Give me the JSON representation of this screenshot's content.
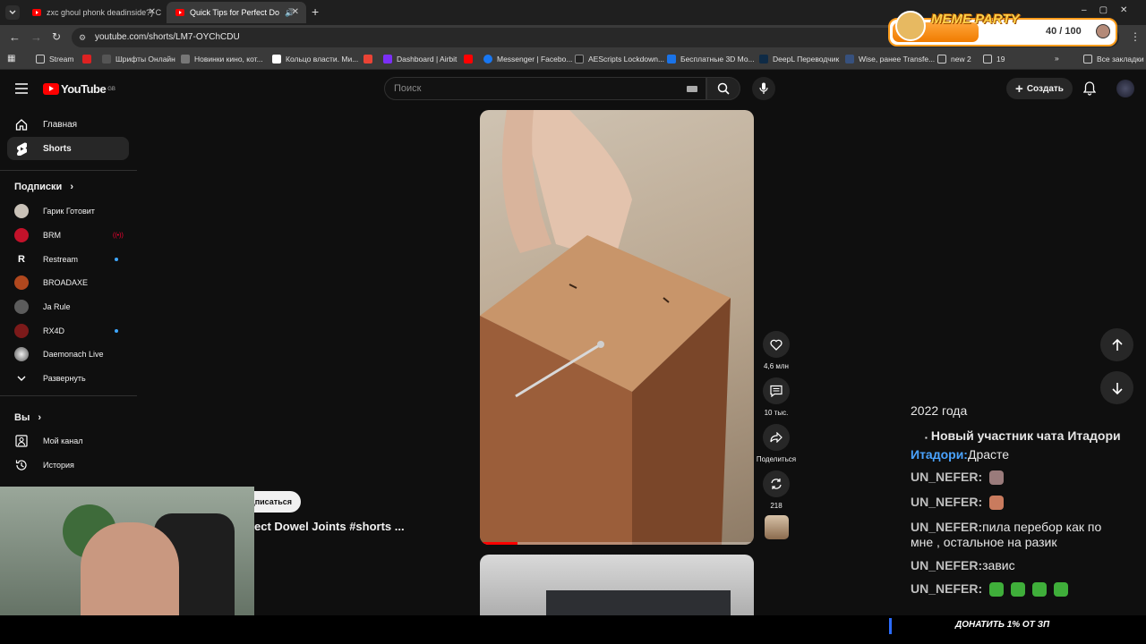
{
  "browser": {
    "tabs": [
      {
        "title": "zxc ghoul phonk deadinside?) C"
      },
      {
        "title": "Quick Tips for Perfect Dowe"
      }
    ],
    "url": "youtube.com/shorts/LM7-OYChCDU",
    "bookmarks": [
      "Stream",
      "Шрифты Онлайн",
      "Новинки кино, кот...",
      "Кольцо власти. Ми...",
      "Dashboard | Airbit",
      "Messenger | Facebo...",
      "AEScripts Lockdown...",
      "Бесплатные 3D Мо...",
      "DeepL Переводчик",
      "Wise, ранее Transfe...",
      "new 2",
      "19"
    ],
    "all_bookmarks": "Все закладки"
  },
  "overlay": {
    "brand": "MEME PARTY",
    "counter": "40 / 100",
    "bottom_banner": "ДОНАТИТЬ 1% ОТ ЗП"
  },
  "youtube": {
    "logo": "YouTube",
    "region": "GB",
    "search_placeholder": "Поиск",
    "create_label": "Создать",
    "nav": [
      {
        "label": "Главная",
        "icon": "home-icon"
      },
      {
        "label": "Shorts",
        "icon": "shorts-icon"
      }
    ],
    "subs_header": "Подписки",
    "subscriptions": [
      {
        "name": "Гарик Готовит"
      },
      {
        "name": "BRM"
      },
      {
        "name": "Restream"
      },
      {
        "name": "BROADAXE"
      },
      {
        "name": "Ja Rule"
      },
      {
        "name": "RX4D"
      },
      {
        "name": "Daemonach Live"
      }
    ],
    "expand_label": "Развернуть",
    "you_header": "Вы",
    "you_items": [
      {
        "label": "Мой канал"
      },
      {
        "label": "История"
      }
    ],
    "subscribe_btn": "дписаться",
    "short_title": "ect Dowel Joints #shorts ...",
    "actions": {
      "likes": "4,6 млн",
      "comments": "10 тыс.",
      "share": "Поделиться",
      "remix": "218"
    }
  },
  "chat": {
    "year": "2022 года",
    "system": "Новый участник чата Итадори",
    "messages": [
      {
        "user": "Итадори:",
        "text": "Драсте"
      },
      {
        "user": "UN_NEFER:",
        "text": ""
      },
      {
        "user": "UN_NEFER:",
        "text": ""
      },
      {
        "user": "UN_NEFER:",
        "text": "пила перебор как по мне , остальное на разик"
      },
      {
        "user": "UN_NEFER:",
        "text": "завис"
      },
      {
        "user": "UN_NEFER:",
        "text": ""
      }
    ]
  }
}
